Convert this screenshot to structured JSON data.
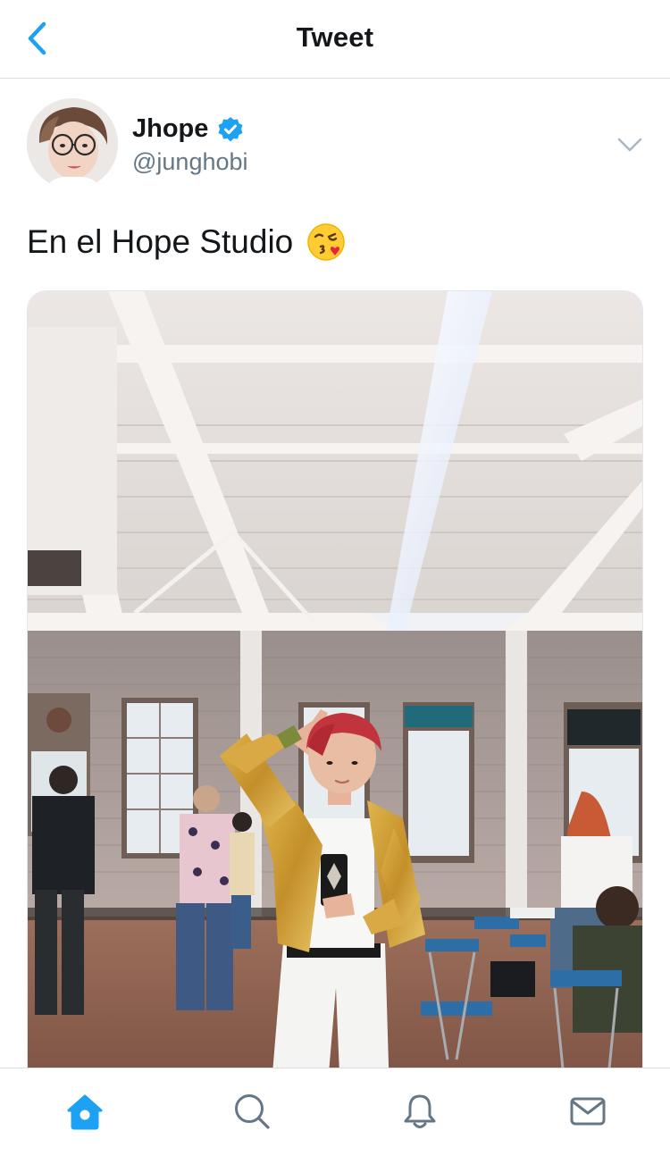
{
  "header": {
    "title": "Tweet",
    "back_icon": "chevron-left-icon"
  },
  "tweet": {
    "author": {
      "display_name": "Jhope",
      "handle": "@junghobi",
      "verified": true,
      "avatar": "avatar-photo"
    },
    "text": "En el Hope Studio",
    "emoji": "face-blowing-a-kiss",
    "media": {
      "type": "photo",
      "subject": "mirror-selfie-in-studio"
    }
  },
  "tabbar": {
    "items": [
      {
        "name": "home",
        "icon": "home-icon",
        "active": true
      },
      {
        "name": "search",
        "icon": "search-icon",
        "active": false
      },
      {
        "name": "notifications",
        "icon": "bell-icon",
        "active": false
      },
      {
        "name": "messages",
        "icon": "mail-icon",
        "active": false
      }
    ]
  },
  "colors": {
    "accent": "#1da1f2",
    "text_primary": "#14171a",
    "text_secondary": "#657786",
    "divider": "#d8dde1",
    "icon_inactive": "#657786"
  }
}
